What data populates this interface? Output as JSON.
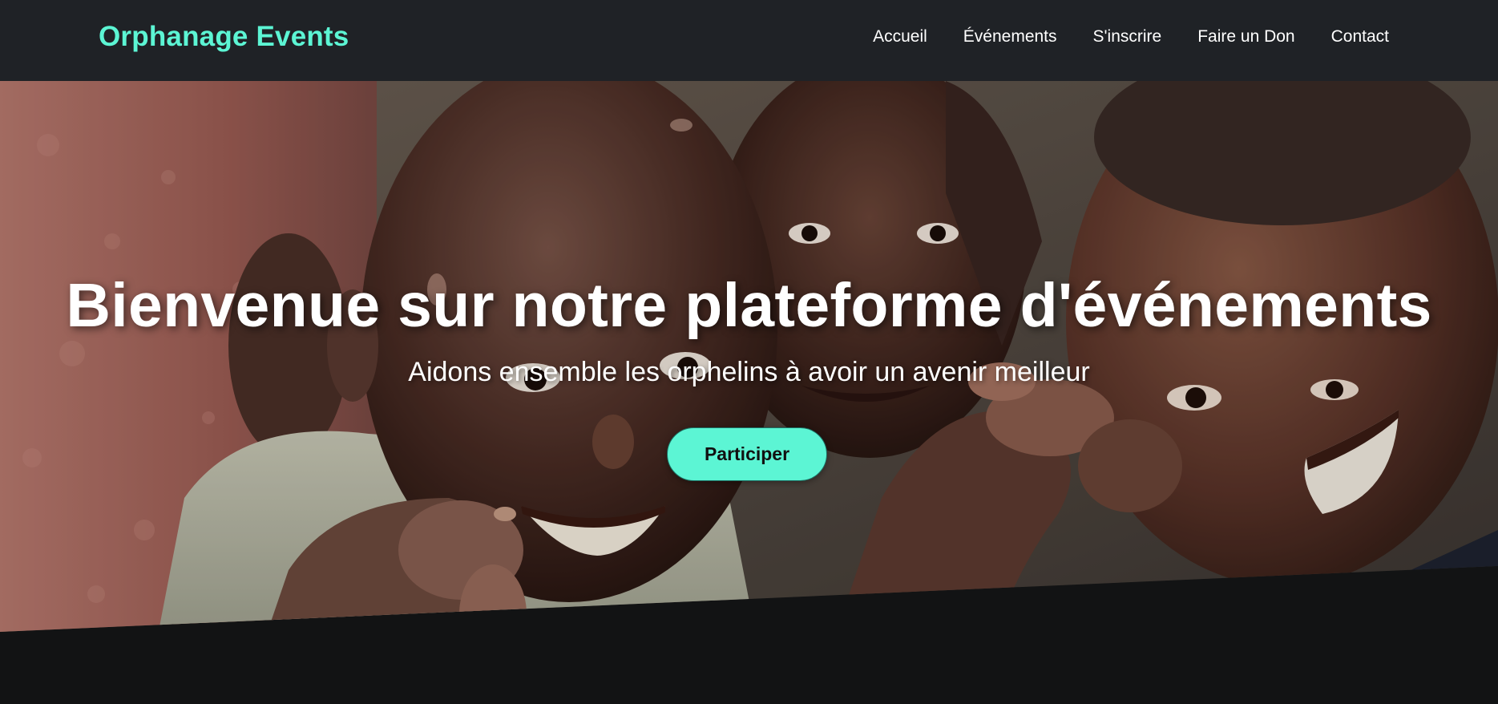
{
  "navbar": {
    "brand": "Orphanage Events",
    "links": [
      "Accueil",
      "Événements",
      "S'inscrire",
      "Faire un Don",
      "Contact"
    ]
  },
  "hero": {
    "title": "Bienvenue sur notre plateforme d'événements",
    "subtitle": "Aidons ensemble les orphelins à avoir un avenir meilleur",
    "cta_label": "Participer"
  },
  "colors": {
    "accent": "#5cf5d4",
    "navbar_bg": "#1f2226",
    "page_bg": "#121314"
  }
}
